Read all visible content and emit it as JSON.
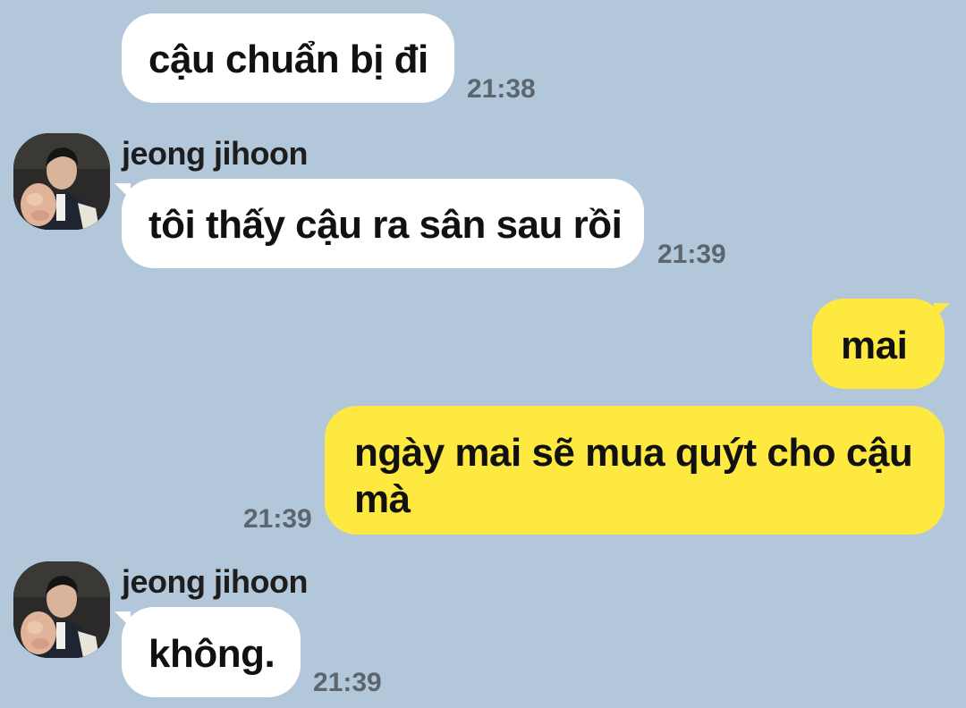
{
  "colors": {
    "background": "#b2c7d9",
    "incoming_bubble": "#ffffff",
    "outgoing_bubble": "#fee940",
    "timestamp": "#5c6670"
  },
  "messages": [
    {
      "direction": "incoming",
      "text": "cậu chuẩn bị đi",
      "time": "21:38"
    },
    {
      "direction": "incoming",
      "sender": "jeong jihoon",
      "avatar": "profile-photo",
      "text": "tôi thấy cậu ra sân sau rồi",
      "time": "21:39"
    },
    {
      "direction": "outgoing",
      "text": "mai"
    },
    {
      "direction": "outgoing",
      "text": "ngày mai sẽ mua quýt cho cậu mà",
      "time": "21:39"
    },
    {
      "direction": "incoming",
      "sender": "jeong jihoon",
      "avatar": "profile-photo",
      "text": "không.",
      "time": "21:39"
    }
  ]
}
